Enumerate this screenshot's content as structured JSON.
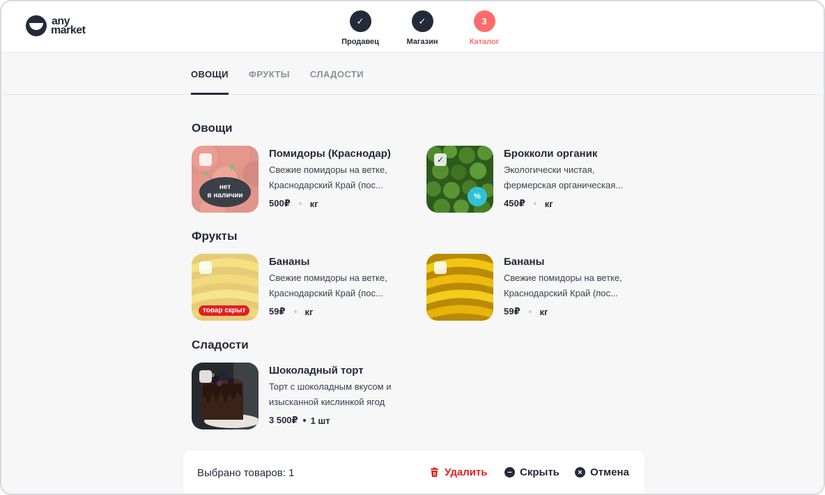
{
  "header": {
    "logo_line1": "any",
    "logo_line2": "market",
    "steps": [
      {
        "label": "Продавец",
        "marker": "✓",
        "state": "done"
      },
      {
        "label": "Магазин",
        "marker": "✓",
        "state": "done"
      },
      {
        "label": "Каталог",
        "marker": "3",
        "state": "active"
      }
    ]
  },
  "tabs": [
    {
      "label": "ОВОЩИ",
      "active": true
    },
    {
      "label": "ФРУКТЫ",
      "active": false
    },
    {
      "label": "СЛАДОСТИ",
      "active": false
    }
  ],
  "sections": [
    {
      "title": "Овощи",
      "products": [
        {
          "name": "Помидоры (Краснодар)",
          "desc1": "Свежие помидоры на ветке,",
          "desc2": "Краснодарский Край (пос...",
          "price": "500₽",
          "unit": "кг",
          "checked": false,
          "badge_line1": "нет",
          "badge_line2": "в наличии",
          "image": "tomatoes"
        },
        {
          "name": "Брокколи органик",
          "desc1": "Экологически чистая,",
          "desc2": "фермерская органическая...",
          "price": "450₽",
          "unit": "кг",
          "checked": true,
          "sale_icon": "%",
          "image": "broccoli"
        }
      ]
    },
    {
      "title": "Фрукты",
      "products": [
        {
          "name": "Бананы",
          "desc1": "Свежие помидоры на ветке,",
          "desc2": "Краснодарский Край (пос...",
          "price": "59₽",
          "unit": "кг",
          "checked": false,
          "hidden_badge": "товар скрыт",
          "image": "bananas"
        },
        {
          "name": "Бананы",
          "desc1": "Свежие помидоры на ветке,",
          "desc2": "Краснодарский Край (пос...",
          "price": "59₽",
          "unit": "кг",
          "checked": false,
          "image": "bananas"
        }
      ]
    },
    {
      "title": "Сладости",
      "products": [
        {
          "name": "Шоколадный торт",
          "desc1": "Торт с шоколадным вкусом и",
          "desc2": "изысканной кислинкой ягод",
          "price": "3 500₽",
          "unit": "1 шт",
          "checked": false,
          "image": "chocolate-cake"
        }
      ]
    }
  ],
  "bottom_bar": {
    "selected_text": "Выбрано товаров: 1",
    "delete_label": "Удалить",
    "hide_label": "Скрыть",
    "cancel_label": "Отмена",
    "delete_icon_glyph": "🗑",
    "hide_icon_glyph": "−",
    "cancel_icon_glyph": "×"
  },
  "colors": {
    "primary": "#232a3a",
    "accent": "#ff6b6b",
    "danger": "#e22020",
    "sale": "#2fc2d6"
  }
}
